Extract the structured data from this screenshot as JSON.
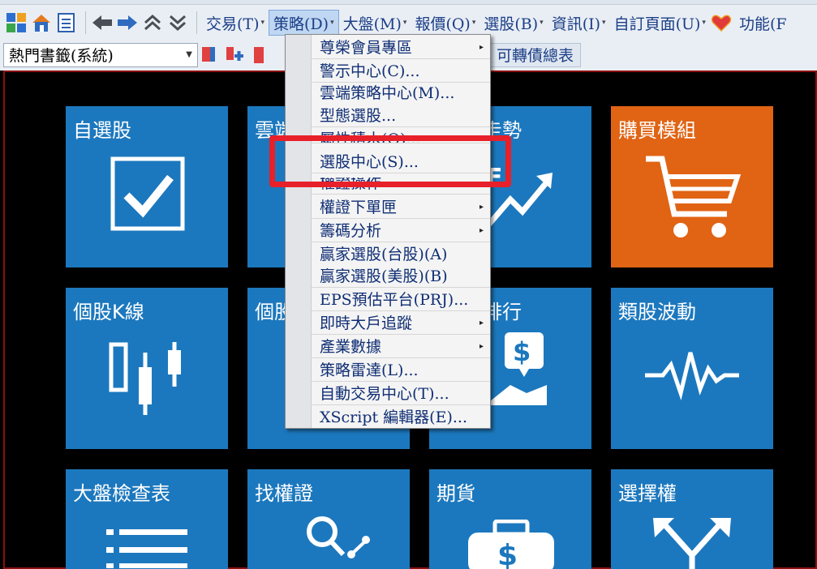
{
  "toolbar": {
    "menus": [
      {
        "label": "交易(T)"
      },
      {
        "label": "策略(D)"
      },
      {
        "label": "大盤(M)"
      },
      {
        "label": "報價(Q)"
      },
      {
        "label": "選股(B)"
      },
      {
        "label": "資訊(I)"
      },
      {
        "label": "自訂頁面(U)"
      },
      {
        "label": "功能(F"
      }
    ],
    "bookmark_value": "熱門書籤(系統)",
    "convertible_button": "可轉債總表"
  },
  "dropdown": {
    "items": [
      {
        "label": "尊榮會員專區",
        "submenu": true
      },
      {
        "label": "警示中心(C)...",
        "submenu": false
      },
      {
        "label": "雲端策略中心(M)...",
        "submenu": false
      },
      {
        "label": "型態選股...",
        "submenu": false
      },
      {
        "label": "屬性積木(O)...",
        "submenu": false
      },
      {
        "label": "選股中心(S)...",
        "submenu": false
      },
      {
        "label": "權證操作",
        "submenu": false
      },
      {
        "label": "權證下單匣",
        "submenu": true
      },
      {
        "label": "籌碼分析",
        "submenu": true
      },
      {
        "label": "贏家選股(台股)(A)",
        "submenu": false
      },
      {
        "label": "贏家選股(美股)(B)",
        "submenu": false
      },
      {
        "label": "EPS預估平台(PRJ)...",
        "submenu": false
      },
      {
        "label": "即時大戶追蹤",
        "submenu": true
      },
      {
        "label": "產業數據",
        "submenu": true
      },
      {
        "label": "策略雷達(L)...",
        "submenu": false
      },
      {
        "label": "自動交易中心(T)...",
        "submenu": false
      },
      {
        "label": "XScript 編輯器(E)...",
        "submenu": false
      }
    ]
  },
  "tiles": {
    "t1": "自選股",
    "t2": "雲端",
    "t3": "走勢",
    "t4": "購買模組",
    "t5": "個股K線",
    "t6": "個股",
    "t7": "排行",
    "t8": "類股波動",
    "t9": "大盤檢查表",
    "t10": "找權證",
    "t11": "期貨",
    "t12": "選擇權"
  },
  "colors": {
    "tile_blue": "#1c78be",
    "tile_orange": "#e06414",
    "highlight_red": "#e82029",
    "frame_red": "#8b1010"
  }
}
